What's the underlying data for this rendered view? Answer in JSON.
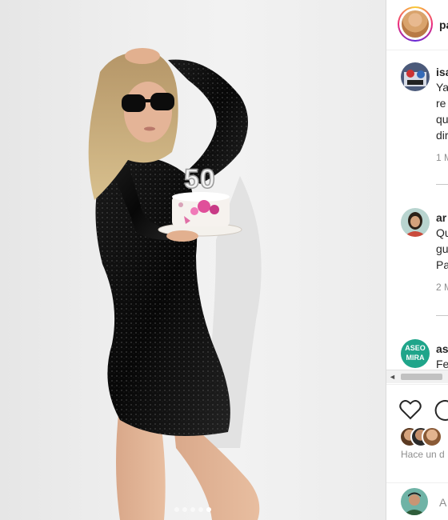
{
  "post": {
    "username": "pa",
    "carousel": {
      "count": 5,
      "active_index": 4
    },
    "cake_topper": "50"
  },
  "comments": [
    {
      "username": "isa",
      "lines": [
        "Ya",
        "re",
        "qu",
        "dir"
      ],
      "meta": "1 M",
      "avatar": "avatar-isa"
    },
    {
      "username": "ar",
      "lines": [
        "Qu",
        "gu",
        "Pa"
      ],
      "meta": "2 M",
      "avatar": "avatar-ar"
    },
    {
      "username": "as",
      "lines": [
        "Fe"
      ],
      "meta": "",
      "avatar": "avatar-asp",
      "avatar_text": [
        "ASEO",
        "MIRA"
      ]
    }
  ],
  "scrollbar": {
    "left_arrow": "◄"
  },
  "actions": {
    "like_icon": "heart-icon",
    "comment_icon": "comment-icon",
    "time": "Hace un d"
  },
  "add_comment": {
    "placeholder": "A"
  },
  "colors": {
    "accent_green": "#1fa58a",
    "text": "#262626",
    "muted": "#8e8e8e"
  }
}
